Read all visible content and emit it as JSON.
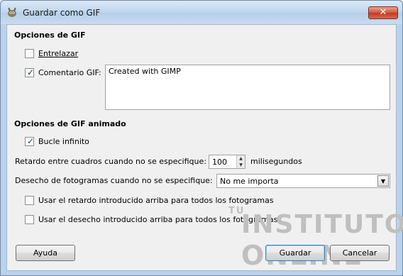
{
  "window": {
    "title": "Guardar como GIF",
    "close_glyph": "✕"
  },
  "gif_options": {
    "section_title": "Opciones de GIF",
    "interlace": {
      "label": "Entrelazar",
      "checked": false
    },
    "comment": {
      "label": "Comentario GIF:",
      "checked": true,
      "value": "Created with GIMP"
    }
  },
  "animated_options": {
    "section_title": "Opciones de GIF animado",
    "loop": {
      "label": "Bucle infinito",
      "checked": true
    },
    "delay": {
      "label": "Retardo entre cuadros cuando no se especifique:",
      "value": "100",
      "unit": "milisegundos"
    },
    "disposal": {
      "label": "Desecho de fotogramas cuando no se especifique:",
      "selected": "No me importa"
    },
    "use_delay": {
      "label": "Usar el retardo introducido arriba para todos los fotogramas",
      "checked": false
    },
    "use_disposal": {
      "label": "Usar el desecho introducido arriba para todos los fotogramas",
      "checked": false
    }
  },
  "buttons": {
    "help": "Ayuda",
    "save": "Guardar",
    "cancel": "Cancelar"
  },
  "watermark": {
    "line1": "TU",
    "line2": "INSTITUTO",
    "line3": "ONLINE"
  },
  "colors": {
    "title_bar": "#c2d8ef",
    "client_bg": "#f0f0f0",
    "close_button": "#c23a22",
    "default_button_border": "#3c7fb1"
  },
  "icons": [
    "gimp-icon",
    "close-icon",
    "checkbox-checked",
    "checkbox-unchecked",
    "spin-up-icon",
    "spin-down-icon",
    "dropdown-arrow-icon"
  ]
}
